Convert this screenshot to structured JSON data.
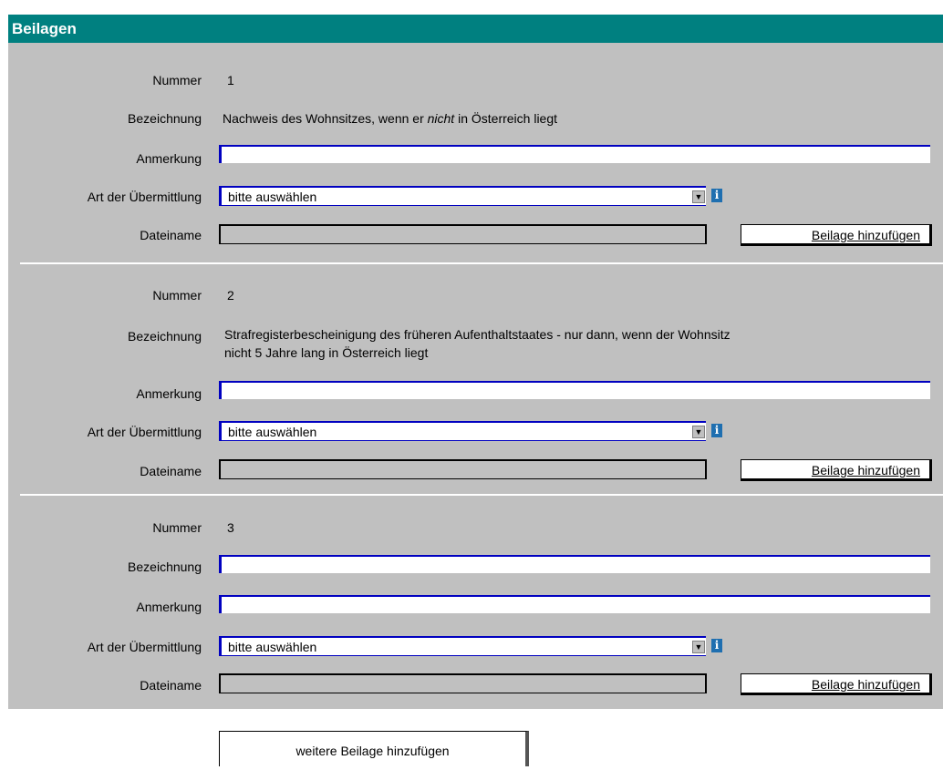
{
  "header": {
    "title": "Beilagen"
  },
  "labels": {
    "nummer": "Nummer",
    "bezeichnung": "Bezeichnung",
    "anmerkung": "Anmerkung",
    "art": "Art der Übermittlung",
    "dateiname": "Dateiname"
  },
  "attachments": [
    {
      "nummer": "1",
      "bezeichnung_pre": "Nachweis des Wohnsitzes, wenn er ",
      "bezeichnung_em": "nicht",
      "bezeichnung_post": " in Österreich liegt",
      "anmerkung": "",
      "art": "bitte auswählen",
      "add_label": "Beilage hinzufügen"
    },
    {
      "nummer": "2",
      "bezeichnung_line1": "Strafregisterbescheinigung des früheren Aufenthaltstaates - nur dann, wenn der Wohnsitz",
      "bezeichnung_line2": "nicht 5 Jahre lang in Österreich liegt",
      "anmerkung": "",
      "art": "bitte auswählen",
      "add_label": "Beilage hinzufügen"
    },
    {
      "nummer": "3",
      "bezeichnung": "",
      "anmerkung": "",
      "art": "bitte auswählen",
      "add_label": "Beilage hinzufügen"
    }
  ],
  "footer": {
    "add_more_label": "weitere Beilage hinzufügen"
  },
  "colors": {
    "header_bg": "#008080",
    "panel_bg": "#c0c0c0",
    "input_accent": "#0000c0"
  },
  "icons": {
    "info": "info-icon",
    "dropdown": "chevron-down-icon"
  }
}
